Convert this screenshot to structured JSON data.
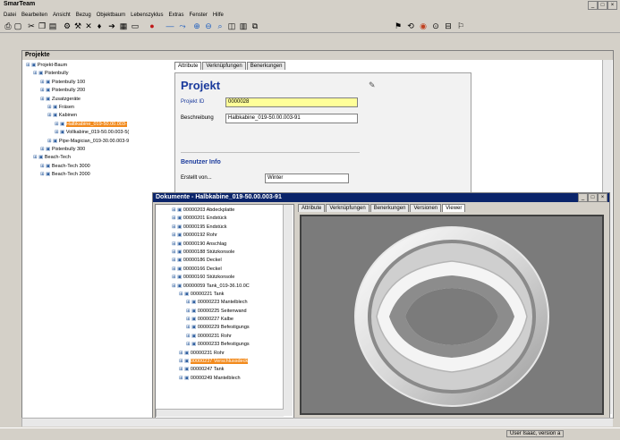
{
  "app": {
    "title": "SmarTeam"
  },
  "menu": [
    "Datei",
    "Bearbeiten",
    "Ansicht",
    "Bezug",
    "Objektbaum",
    "Lebenszyklus",
    "Extras",
    "Fenster",
    "Hilfe"
  ],
  "projects_window": {
    "title": "Projekte"
  },
  "project_tree": [
    {
      "label": "Projekt-Baum",
      "indent": 0,
      "selected": false
    },
    {
      "label": "Pistenbully",
      "indent": 1,
      "selected": false
    },
    {
      "label": "Pistenbully 100",
      "indent": 2,
      "selected": false
    },
    {
      "label": "Pistenbully 200",
      "indent": 2,
      "selected": false
    },
    {
      "label": "Zusatzgeräte",
      "indent": 2,
      "selected": false
    },
    {
      "label": "Fräsen",
      "indent": 3,
      "selected": false
    },
    {
      "label": "Kabinen",
      "indent": 3,
      "selected": false
    },
    {
      "label": "Halbkabine_019-50.00.003-",
      "indent": 4,
      "selected": true
    },
    {
      "label": "Vollkabine_019-50.00.003-5(",
      "indent": 4,
      "selected": false
    },
    {
      "label": "Pipe-Magician_019-30.00.003-9",
      "indent": 3,
      "selected": false
    },
    {
      "label": "Pistenbully 300",
      "indent": 2,
      "selected": false
    },
    {
      "label": "Beach-Tech",
      "indent": 1,
      "selected": false
    },
    {
      "label": "Beach-Tech 3000",
      "indent": 2,
      "selected": false
    },
    {
      "label": "Beach-Tech 2000",
      "indent": 2,
      "selected": false
    }
  ],
  "project_panel": {
    "tabs": [
      "Attribute",
      "Verknüpfungen",
      "Benerkungen"
    ],
    "heading": "Projekt",
    "id_label": "Projekt ID",
    "id_value": "0000028",
    "desc_label": "Beschreibung",
    "desc_value": "Halbkabine_019-50.00.003-91",
    "user_heading": "Benutzer Info",
    "created_label": "Erstellt von...",
    "created_value": "Winter"
  },
  "documents_window": {
    "title": "Dokumente - Halbkabine_019-50.00.003-91",
    "tabs": [
      "Attribute",
      "Verknüpfungen",
      "Benerkungen",
      "Versionen",
      "Viewer"
    ],
    "active_tab": "Viewer"
  },
  "doc_tree": [
    {
      "label": "00000203 Abdeckplatte",
      "indent": 0,
      "selected": false
    },
    {
      "label": "00000201 Endstück",
      "indent": 0,
      "selected": false
    },
    {
      "label": "00000195 Endstück",
      "indent": 0,
      "selected": false
    },
    {
      "label": "00000192 Rohr",
      "indent": 0,
      "selected": false
    },
    {
      "label": "00000190 Anschlag",
      "indent": 0,
      "selected": false
    },
    {
      "label": "00000188 Stützkonsole",
      "indent": 0,
      "selected": false
    },
    {
      "label": "00000186 Deckel",
      "indent": 0,
      "selected": false
    },
    {
      "label": "00000166 Deckel",
      "indent": 0,
      "selected": false
    },
    {
      "label": "00000160 Stützkonsole",
      "indent": 0,
      "selected": false
    },
    {
      "label": "00000059 Tank_019-36.10.0C",
      "indent": 0,
      "selected": false
    },
    {
      "label": "00000221 Tank",
      "indent": 1,
      "selected": false
    },
    {
      "label": "00000223 Mantelblech",
      "indent": 2,
      "selected": false
    },
    {
      "label": "00000225 Seitenwand",
      "indent": 2,
      "selected": false
    },
    {
      "label": "00000227 Kalbe",
      "indent": 2,
      "selected": false
    },
    {
      "label": "00000229 Befestigungs",
      "indent": 2,
      "selected": false
    },
    {
      "label": "00000231 Rohr",
      "indent": 2,
      "selected": false
    },
    {
      "label": "00000233 Befestigungs",
      "indent": 2,
      "selected": false
    },
    {
      "label": "00000231 Rohr",
      "indent": 1,
      "selected": false
    },
    {
      "label": "00000237 Verschlussdeck",
      "indent": 1,
      "selected": true
    },
    {
      "label": "00000247 Tank",
      "indent": 1,
      "selected": false
    },
    {
      "label": "00000249 Mantelblech",
      "indent": 1,
      "selected": false
    }
  ],
  "status": {
    "text": "User Isaac, version a"
  },
  "colors": {
    "selection": "#f28a1c",
    "title_bar": "#0a246a",
    "heading": "#1a3a9c",
    "field_highlight": "#ffff99"
  }
}
